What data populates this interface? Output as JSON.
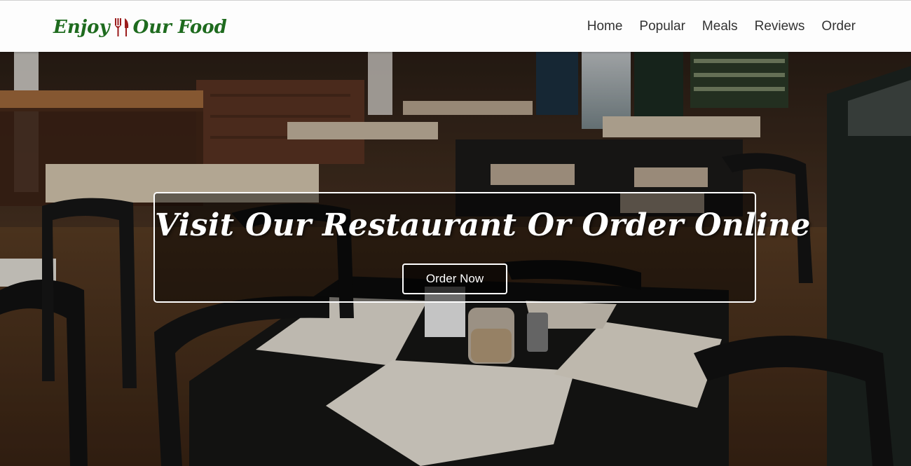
{
  "brand": {
    "text_left": "Enjoy",
    "text_right": "Our Food",
    "icon": "fork-knife-icon",
    "color": "#1e6b1e",
    "icon_color": "#9b1c1c"
  },
  "nav": {
    "items": [
      {
        "label": "Home"
      },
      {
        "label": "Popular"
      },
      {
        "label": "Meals"
      },
      {
        "label": "Reviews"
      },
      {
        "label": "Order"
      }
    ]
  },
  "hero": {
    "title": "Visit Our Restaurant Or Order Online",
    "button_label": "Order Now"
  }
}
